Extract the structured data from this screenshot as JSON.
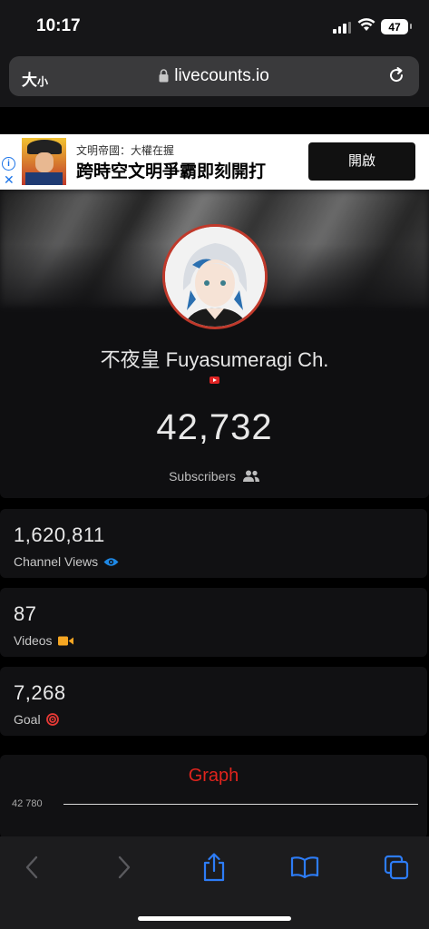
{
  "status_bar": {
    "time": "10:17",
    "battery": "47"
  },
  "browser": {
    "text_size_label_big": "大",
    "text_size_label_small": "小",
    "url": "livecounts.io"
  },
  "ad": {
    "subtitle": "文明帝國：大權在握",
    "title": "跨時空文明爭霸即刻開打",
    "button": "開啟"
  },
  "channel": {
    "name": "不夜皇 Fuyasumeragi Ch.",
    "subscribers": "42,732",
    "subscribers_label": "Subscribers"
  },
  "stats": [
    {
      "value": "1,620,811",
      "label": "Channel Views",
      "icon": "eye-icon",
      "color": "#1e88e5"
    },
    {
      "value": "87",
      "label": "Videos",
      "icon": "video-camera-icon",
      "color": "#f5a623"
    },
    {
      "value": "7,268",
      "label": "Goal",
      "icon": "target-icon",
      "color": "#e53935"
    }
  ],
  "graph": {
    "title": "Graph",
    "y_tick": "42 780"
  },
  "colors": {
    "accent_red": "#e0241d",
    "ios_blue": "#2d7cf6"
  }
}
